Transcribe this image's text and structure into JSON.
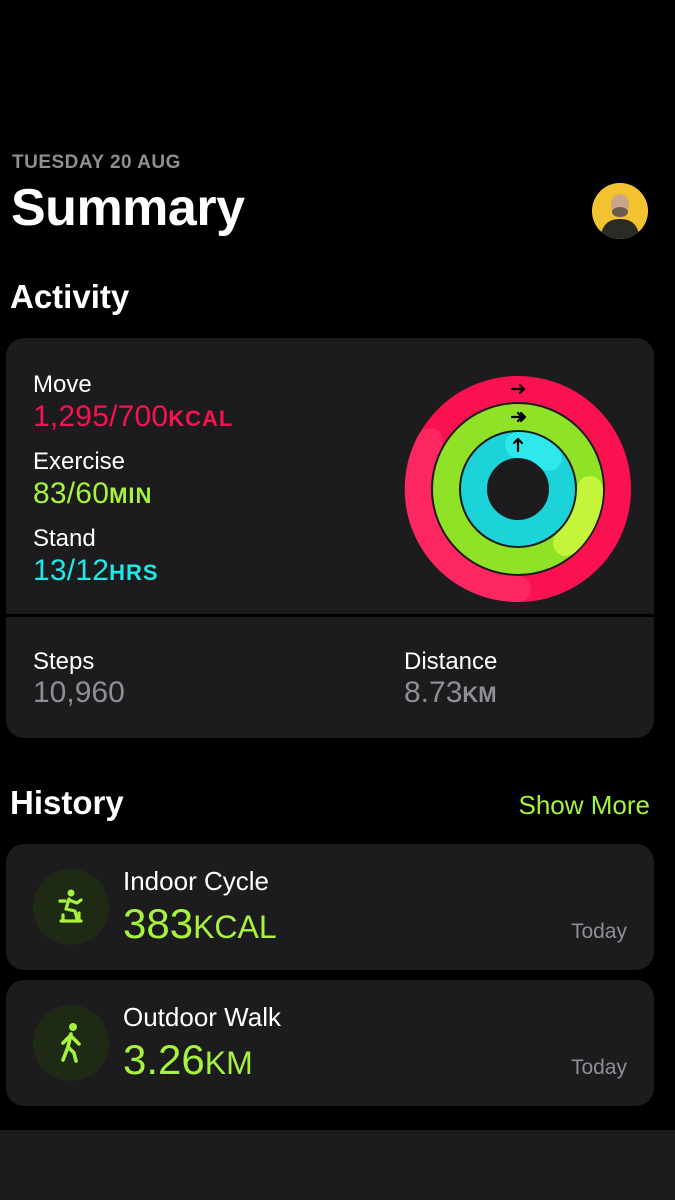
{
  "header": {
    "date": "TUESDAY 20 AUG",
    "title": "Summary"
  },
  "activity": {
    "section_title": "Activity",
    "move": {
      "label": "Move",
      "value": "1,295/700",
      "unit": "KCAL",
      "progress": 1.85,
      "color": "#fa114f"
    },
    "exercise": {
      "label": "Exercise",
      "value": "83/60",
      "unit": "MIN",
      "progress": 1.38,
      "color": "#a6f23d"
    },
    "stand": {
      "label": "Stand",
      "value": "13/12",
      "unit": "HRS",
      "progress": 1.08,
      "color": "#1de9e9"
    },
    "steps": {
      "label": "Steps",
      "value": "10,960"
    },
    "distance": {
      "label": "Distance",
      "value": "8.73",
      "unit": "KM"
    }
  },
  "history": {
    "section_title": "History",
    "show_more": "Show More",
    "items": [
      {
        "title": "Indoor Cycle",
        "value": "383",
        "unit": "KCAL",
        "date": "Today",
        "icon": "indoor-cycle-icon"
      },
      {
        "title": "Outdoor Walk",
        "value": "3.26",
        "unit": "KM",
        "date": "Today",
        "icon": "outdoor-walk-icon"
      }
    ]
  },
  "colors": {
    "move": "#fa114f",
    "exercise": "#a6f23d",
    "stand": "#1de9e9",
    "card": "#1c1c1e",
    "secondary_text": "#8e8e93"
  }
}
